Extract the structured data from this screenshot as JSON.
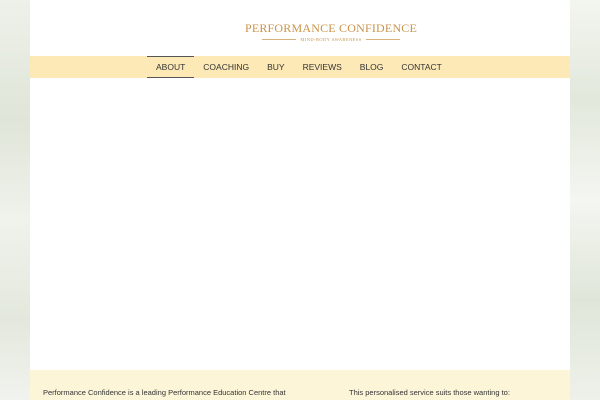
{
  "logo": {
    "title": "PERFORMANCE CONFIDENCE",
    "subtitle": "MIND-BODY AWARENESS"
  },
  "nav": {
    "items": [
      {
        "label": "ABOUT",
        "active": true
      },
      {
        "label": "COACHING"
      },
      {
        "label": "BUY"
      },
      {
        "label": "REVIEWS"
      },
      {
        "label": "BLOG"
      },
      {
        "label": "CONTACT"
      }
    ]
  },
  "info": {
    "left_text": "Performance Confidence is a leading Performance Education Centre that",
    "right_text": "This personalised service suits those wanting to:"
  },
  "colors": {
    "accent": "#c9944a",
    "nav_bg": "#fde9b6",
    "info_bg": "#fdf5d8"
  }
}
